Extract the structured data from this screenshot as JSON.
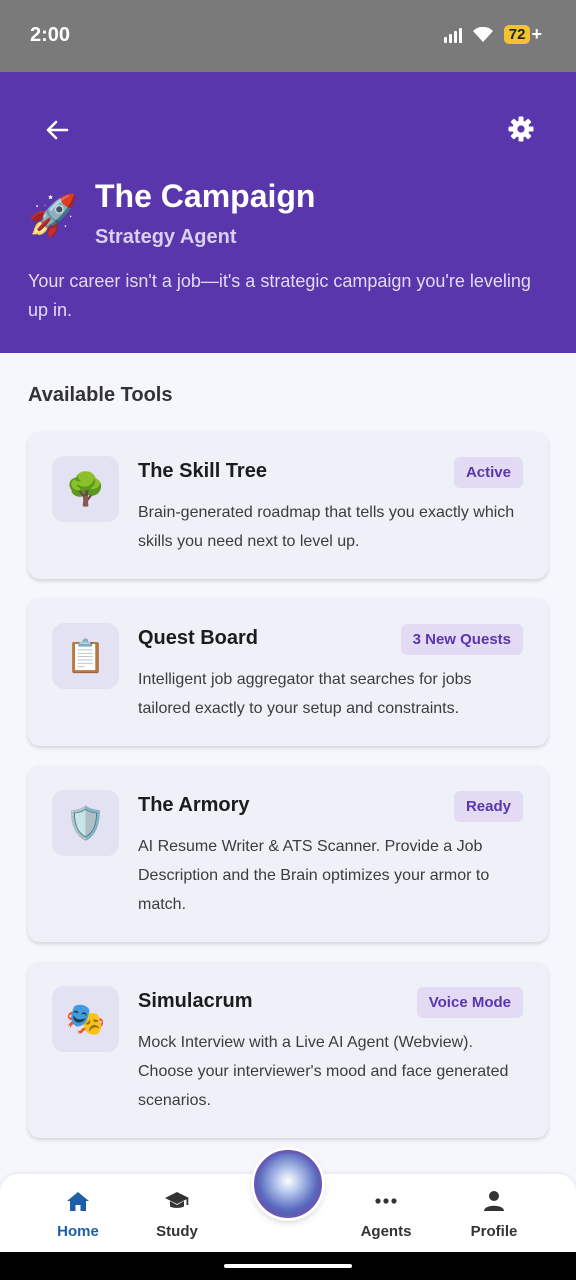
{
  "status": {
    "time": "2:00",
    "battery": "72"
  },
  "header": {
    "title": "The Campaign",
    "subtitle": "Strategy Agent",
    "description": "Your career isn't a job—it's a strategic campaign you're leveling up in."
  },
  "section_title": "Available Tools",
  "tools": [
    {
      "icon": "tree-icon",
      "emoji": "🌳",
      "title": "The Skill Tree",
      "badge": "Active",
      "description": "Brain-generated roadmap that tells you exactly which skills you need next to level up."
    },
    {
      "icon": "clipboard-icon",
      "emoji": "📋",
      "title": "Quest Board",
      "badge": "3 New Quests",
      "description": "Intelligent job aggregator that searches for jobs tailored exactly to your setup and constraints."
    },
    {
      "icon": "shield-icon",
      "emoji": "🛡️",
      "title": "The Armory",
      "badge": "Ready",
      "description": "AI Resume Writer & ATS Scanner. Provide a Job Description and the Brain optimizes your armor to match."
    },
    {
      "icon": "theater-masks-icon",
      "emoji": "🎭",
      "title": "Simulacrum",
      "badge": "Voice Mode",
      "description": "Mock Interview with a Live AI Agent (Webview). Choose your interviewer's mood and face generated scenarios."
    }
  ],
  "nav": {
    "home": "Home",
    "study": "Study",
    "agents": "Agents",
    "profile": "Profile"
  },
  "colors": {
    "header": "#5a36ad",
    "badge_bg": "#e2dbf3",
    "badge_text": "#5a36ad",
    "nav_active": "#1f5fa6"
  }
}
